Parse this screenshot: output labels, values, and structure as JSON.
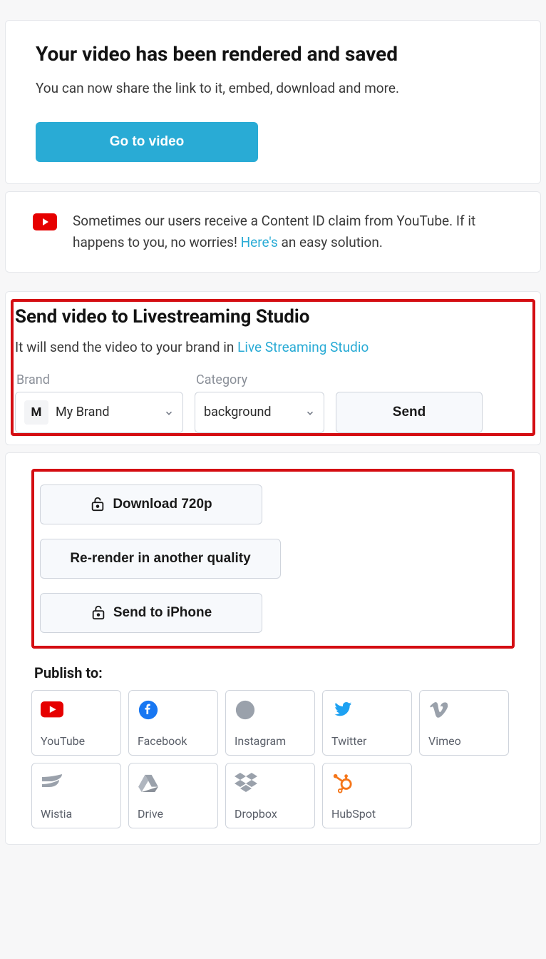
{
  "hero": {
    "title": "Your video has been rendered and saved",
    "subtitle": "You can now share the link to it, embed, download and more.",
    "button": "Go to video"
  },
  "notice": {
    "text_before": "Sometimes our users receive a Content ID claim from YouTube. If it happens to you, no worries! ",
    "link": "Here's",
    "text_after": " an easy solution."
  },
  "livestream": {
    "title": "Send video to Livestreaming Studio",
    "sub_before": "It will send the video to your brand in ",
    "sub_link": "Live Streaming Studio",
    "brand_label": "Brand",
    "brand_badge": "M",
    "brand_value": "My Brand",
    "category_label": "Category",
    "category_value": "background",
    "send": "Send"
  },
  "actions": {
    "download": "Download 720p",
    "rerender": "Re-render in another quality",
    "iphone": "Send to iPhone"
  },
  "publish": {
    "title": "Publish to:",
    "targets": [
      {
        "label": "YouTube"
      },
      {
        "label": "Facebook"
      },
      {
        "label": "Instagram"
      },
      {
        "label": "Twitter"
      },
      {
        "label": "Vimeo"
      },
      {
        "label": "Wistia"
      },
      {
        "label": "Drive"
      },
      {
        "label": "Dropbox"
      },
      {
        "label": "HubSpot"
      }
    ]
  }
}
